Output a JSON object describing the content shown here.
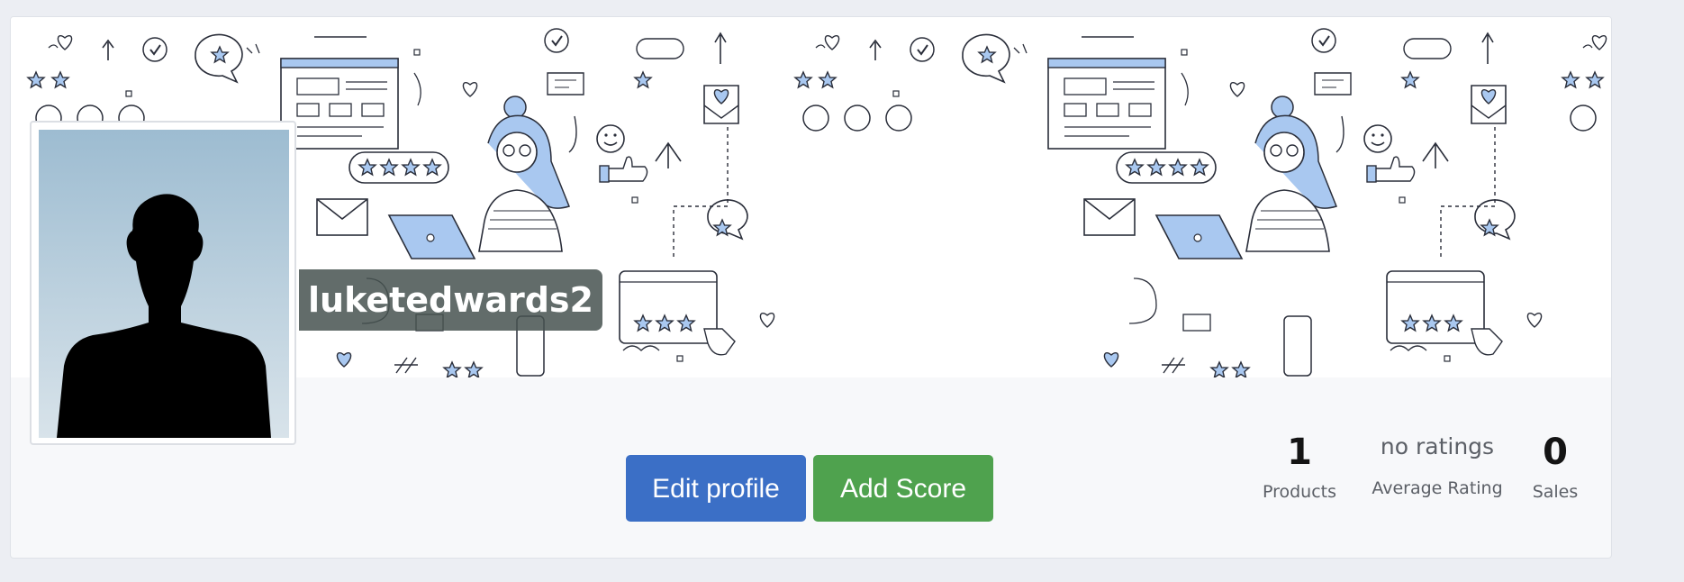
{
  "profile": {
    "username": "luketedwards2"
  },
  "actions": {
    "edit_profile_label": "Edit profile",
    "add_score_label": "Add Score"
  },
  "stats": {
    "products": {
      "value": "1",
      "label": "Products"
    },
    "rating": {
      "value": "no ratings",
      "label": "Average Rating"
    },
    "sales": {
      "value": "0",
      "label": "Sales"
    }
  },
  "colors": {
    "edit_button": "#3b6fc6",
    "add_score_button": "#4fa24e",
    "banner_accent": "#a9c8f0",
    "banner_ink": "#2a2e3a"
  },
  "banner": {
    "pattern": "social feedback doodles: stars, hearts, chat bubbles, emoji faces, laptop user"
  }
}
